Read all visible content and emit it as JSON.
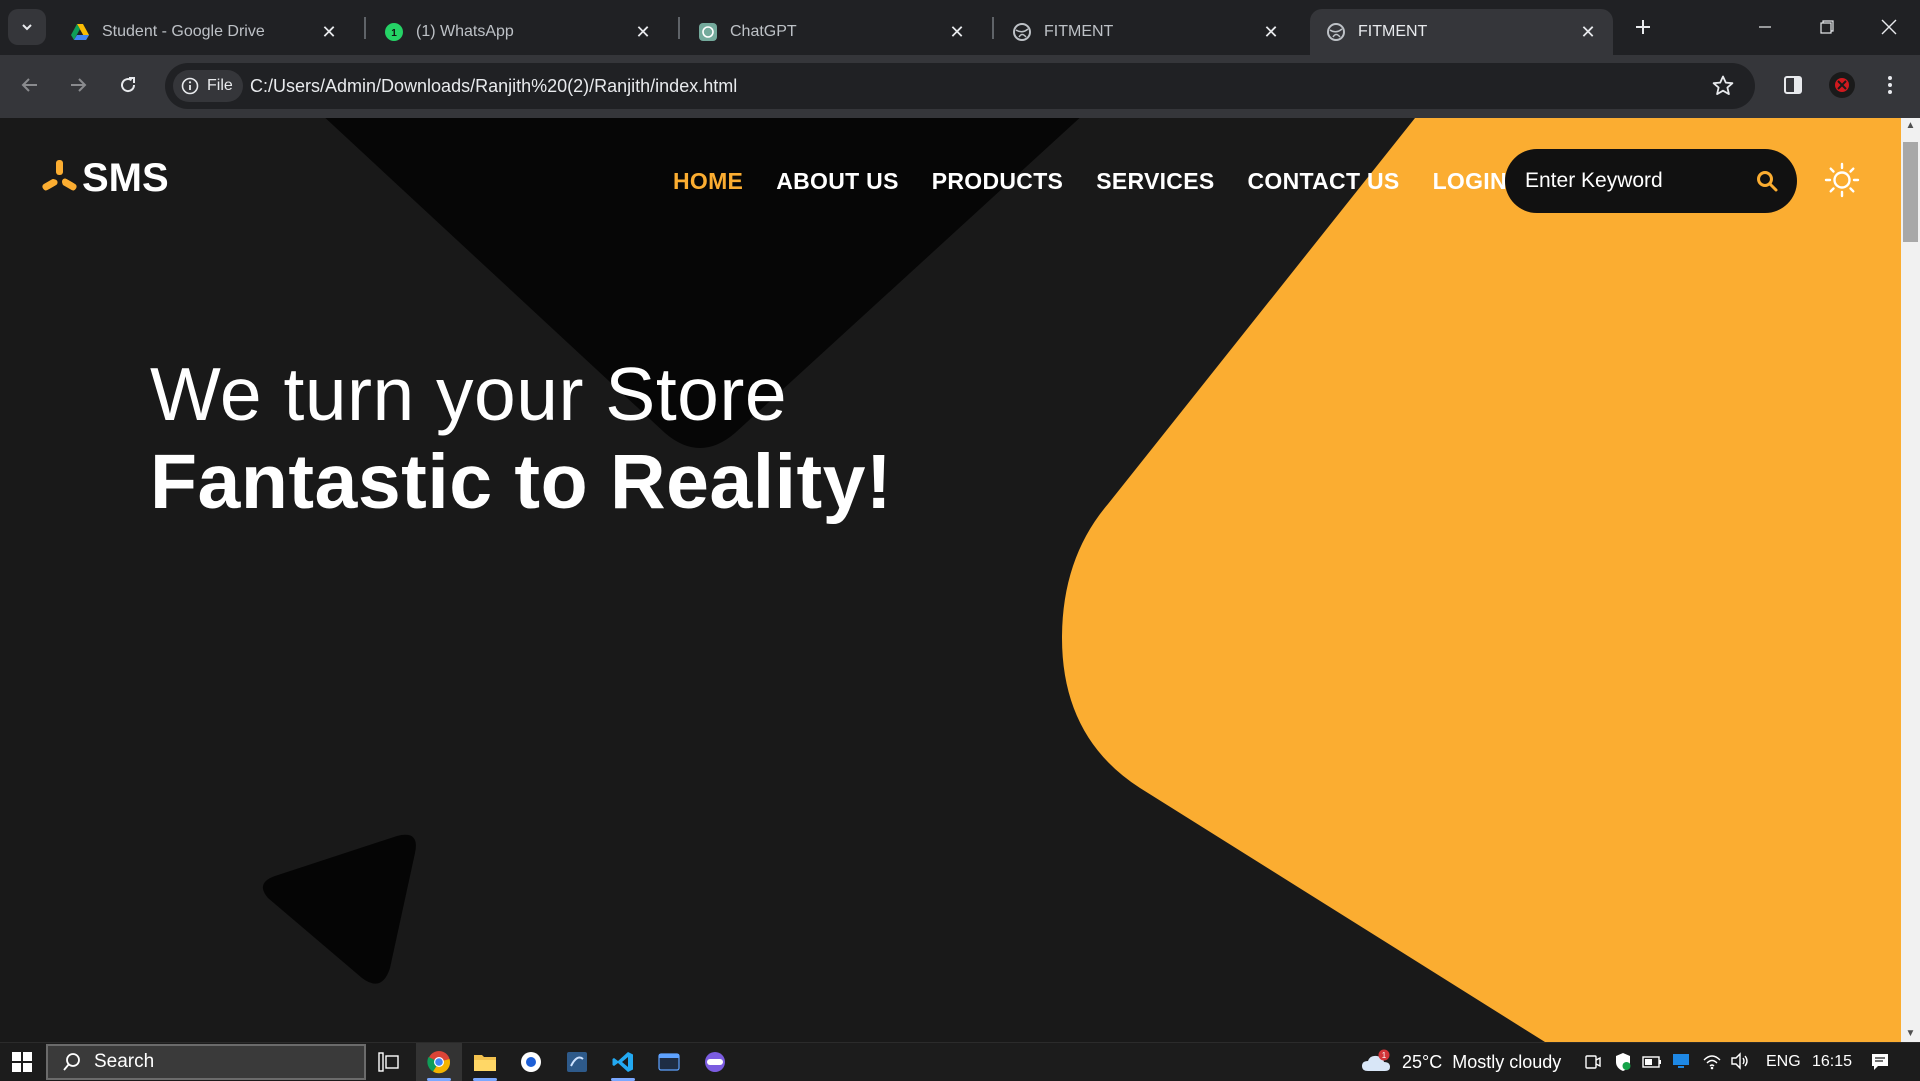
{
  "browser": {
    "tabs": [
      {
        "title": "Student - Google Drive",
        "icon": "google-drive-icon",
        "active": false
      },
      {
        "title": "(1) WhatsApp",
        "icon": "whatsapp-icon",
        "active": false
      },
      {
        "title": "ChatGPT",
        "icon": "chatgpt-icon",
        "active": false
      },
      {
        "title": "FITMENT",
        "icon": "globe-icon",
        "active": false
      },
      {
        "title": "FITMENT",
        "icon": "globe-icon",
        "active": true
      }
    ],
    "address": {
      "chip_label": "File",
      "url": "C:/Users/Admin/Downloads/Ranjith%20(2)/Ranjith/index.html"
    }
  },
  "page": {
    "logo_text": "SMS",
    "nav": [
      "HOME",
      "ABOUT US",
      "PRODUCTS",
      "SERVICES",
      "CONTACT US",
      "LOGIN"
    ],
    "active_nav": "HOME",
    "search_placeholder": "Enter Keyword",
    "hero_line1": "We turn your Store",
    "hero_line2": "Fantastic to Reality!",
    "colors": {
      "accent": "#fbad31",
      "background": "#191919"
    }
  },
  "taskbar": {
    "search_label": "Search",
    "weather_temp": "25°C",
    "weather_text": "Mostly cloudy",
    "weather_badge": "1",
    "language": "ENG",
    "time": "16:15"
  }
}
